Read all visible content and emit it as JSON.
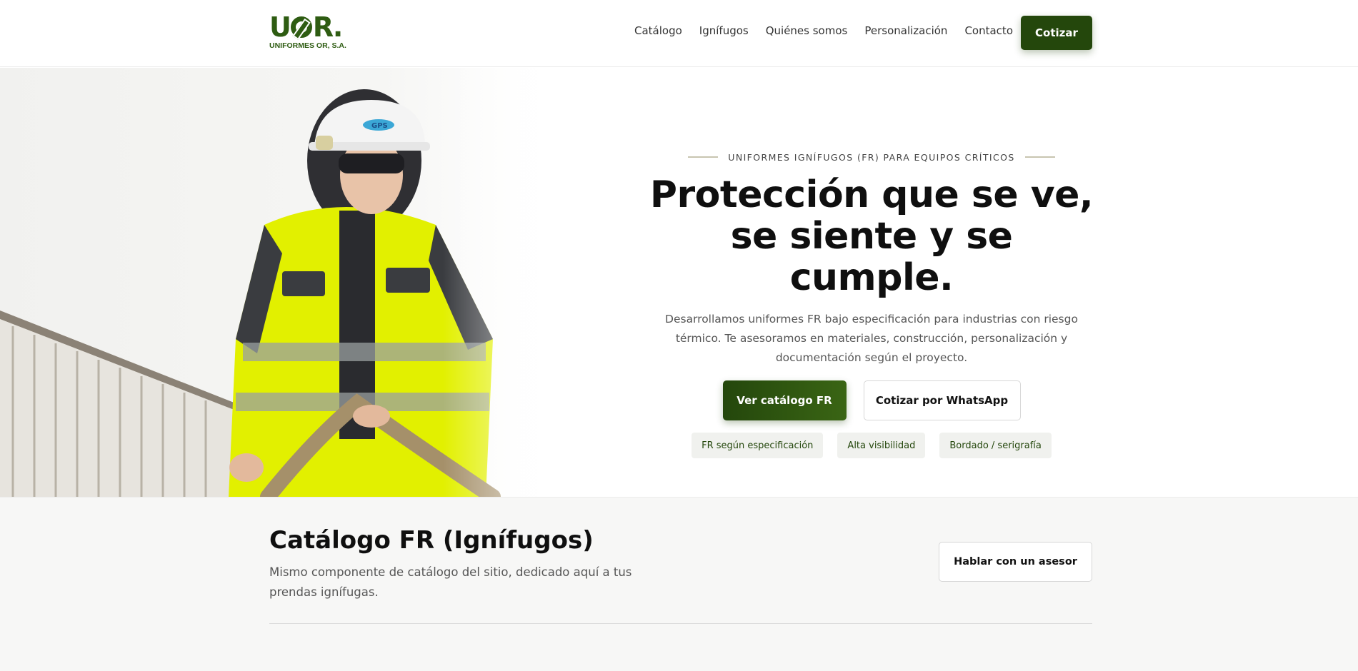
{
  "header": {
    "logo_mark_left": "U",
    "logo_mark_right": "R.",
    "logo_sub": "UNIFORMES OR, S.A.",
    "nav": [
      "Catálogo",
      "Ignífugos",
      "Quiénes somos",
      "Personalización",
      "Contacto"
    ],
    "cta": "Cotizar"
  },
  "hero": {
    "eyebrow": "UNIFORMES IGNÍFUGOS (FR) PARA EQUIPOS CRÍTICOS",
    "headline_line1": "Protección que se ve,",
    "headline_line2": "se siente y se cumple.",
    "lead": "Desarrollamos uniformes FR bajo especificación para industrias con riesgo térmico. Te asesoramos en materiales, construcción, personalización y documentación según el proyecto.",
    "primary_cta": "Ver catálogo FR",
    "secondary_cta": "Cotizar por WhatsApp",
    "chips": [
      "FR según especificación",
      "Alta visibilidad",
      "Bordado / serigrafía"
    ],
    "helmet_text": "GPS"
  },
  "catalog": {
    "title": "Catálogo FR (Ignífugos)",
    "description": "Mismo componente de catálogo del sitio, dedicado aquí a tus prendas ignífugas.",
    "cta": "Hablar con un asesor"
  },
  "colors": {
    "brand_green": "#24470c",
    "logo_green": "#2e5c12",
    "hi_vis_yellow": "#e2f000",
    "chip_bg": "#f0f1ee"
  }
}
